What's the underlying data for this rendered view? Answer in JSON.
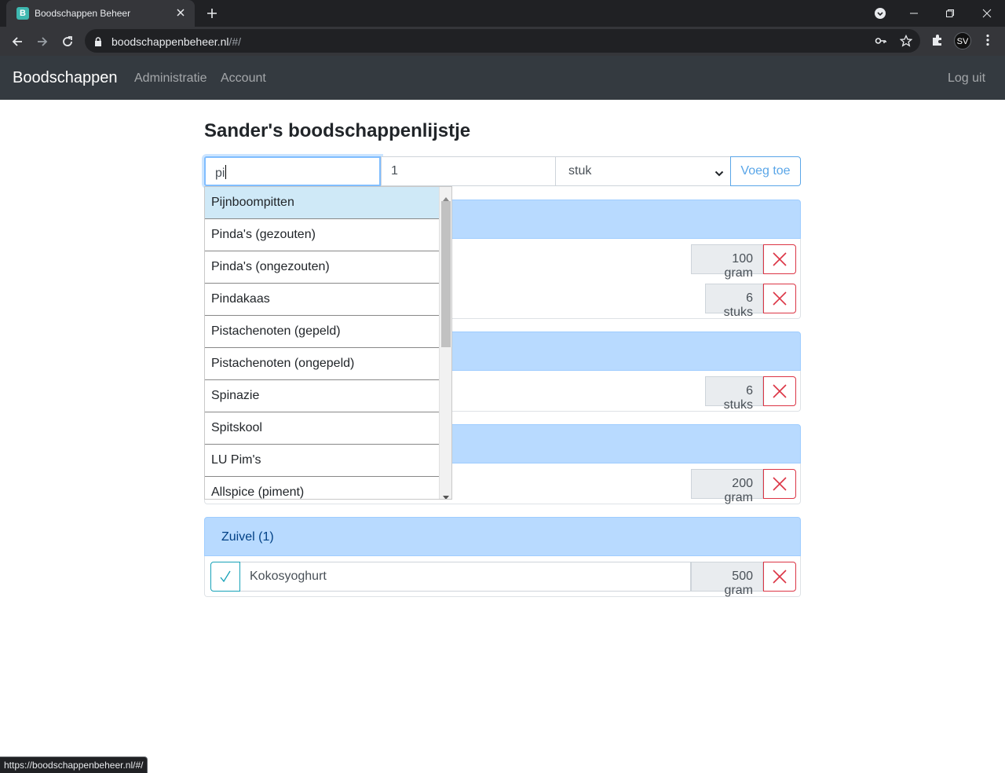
{
  "browser": {
    "tab_title": "Boodschappen Beheer",
    "favicon_letter": "B",
    "url_host": "boodschappenbeheer.nl",
    "url_path": "/#/",
    "profile_initials": "SV",
    "status_url": "https://boodschappenbeheer.nl/#/"
  },
  "navbar": {
    "brand": "Boodschappen",
    "links": [
      "Administratie",
      "Account"
    ],
    "logout": "Log uit"
  },
  "page": {
    "title": "Sander's boodschappenlijstje"
  },
  "form": {
    "product_value": "pi",
    "amount_value": "1",
    "unit_value": "stuk",
    "add_label": "Voeg toe"
  },
  "autocomplete": {
    "items": [
      "Pijnboompitten",
      "Pinda's (gezouten)",
      "Pinda's (ongezouten)",
      "Pindakaas",
      "Pistachenoten (gepeld)",
      "Pistachenoten (ongepeld)",
      "Spinazie",
      "Spitskool",
      "LU Pim's",
      "Allspice (piment)"
    ]
  },
  "categories": [
    {
      "title": "",
      "items": [
        {
          "name": "",
          "qty": "100 gram"
        },
        {
          "name": "",
          "qty": "6 stuks"
        }
      ]
    },
    {
      "title": "",
      "items": [
        {
          "name": "",
          "qty": "6 stuks"
        }
      ]
    },
    {
      "title": "",
      "items": [
        {
          "name": "",
          "qty": "200 gram"
        }
      ]
    },
    {
      "title": "Zuivel (1)",
      "items": [
        {
          "name": "Kokosyoghurt",
          "qty": "500 gram"
        }
      ]
    }
  ],
  "colors": {
    "navbar": "#343a40",
    "category_header": "#b8daff",
    "delete": "#dc3545",
    "check": "#17a2b8"
  }
}
